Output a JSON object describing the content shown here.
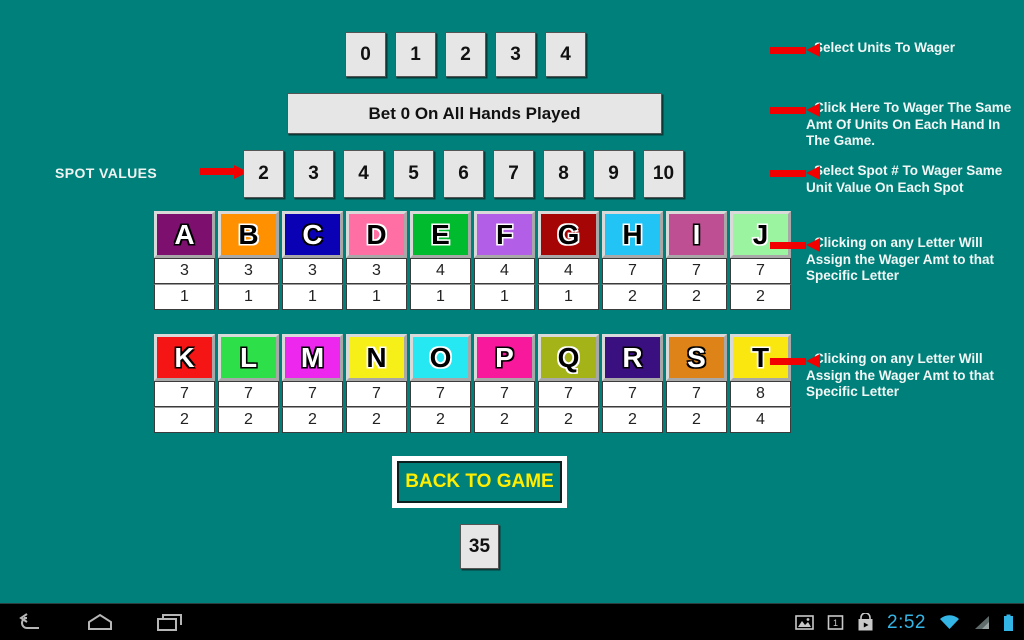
{
  "app": {
    "background_color": "#00807a",
    "accent_red": "#f20000",
    "button_face": "#e6e6e6"
  },
  "units": {
    "label": "units-row",
    "options": [
      "0",
      "1",
      "2",
      "3",
      "4"
    ]
  },
  "bet_all": {
    "label": "Bet 0 On All Hands Played"
  },
  "spot_values": {
    "label": "SPOT VALUES",
    "options": [
      "2",
      "3",
      "4",
      "5",
      "6",
      "7",
      "8",
      "9",
      "10"
    ]
  },
  "letters": {
    "row1": [
      {
        "letter": "A",
        "bg": "#7d0f6e",
        "text": "light",
        "v1": "3",
        "v2": "1"
      },
      {
        "letter": "B",
        "bg": "#ff9000",
        "text": "dark",
        "v1": "3",
        "v2": "1"
      },
      {
        "letter": "C",
        "bg": "#0a00b4",
        "text": "light",
        "v1": "3",
        "v2": "1"
      },
      {
        "letter": "D",
        "bg": "#ff6fa3",
        "text": "dark",
        "v1": "3",
        "v2": "1"
      },
      {
        "letter": "E",
        "bg": "#00bb2d",
        "text": "dark",
        "v1": "4",
        "v2": "1"
      },
      {
        "letter": "F",
        "bg": "#b35ee6",
        "text": "dark",
        "v1": "4",
        "v2": "1"
      },
      {
        "letter": "G",
        "bg": "#a50505",
        "text": "dark",
        "v1": "4",
        "v2": "1"
      },
      {
        "letter": "H",
        "bg": "#22c3f5",
        "text": "dark",
        "v1": "7",
        "v2": "2"
      },
      {
        "letter": "I",
        "bg": "#bd4f92",
        "text": "light",
        "v1": "7",
        "v2": "2"
      },
      {
        "letter": "J",
        "bg": "#9bf5a0",
        "text": "dark",
        "v1": "7",
        "v2": "2"
      }
    ],
    "row2": [
      {
        "letter": "K",
        "bg": "#f51515",
        "text": "light",
        "v1": "7",
        "v2": "2"
      },
      {
        "letter": "L",
        "bg": "#2de04a",
        "text": "light",
        "v1": "7",
        "v2": "2"
      },
      {
        "letter": "M",
        "bg": "#ee27ee",
        "text": "light",
        "v1": "7",
        "v2": "2"
      },
      {
        "letter": "N",
        "bg": "#f7ef18",
        "text": "dark",
        "v1": "7",
        "v2": "2"
      },
      {
        "letter": "O",
        "bg": "#25e8f2",
        "text": "dark",
        "v1": "7",
        "v2": "2"
      },
      {
        "letter": "P",
        "bg": "#f7189b",
        "text": "light",
        "v1": "7",
        "v2": "2"
      },
      {
        "letter": "Q",
        "bg": "#a3b318",
        "text": "dark",
        "v1": "7",
        "v2": "2"
      },
      {
        "letter": "R",
        "bg": "#3a1080",
        "text": "light",
        "v1": "7",
        "v2": "2"
      },
      {
        "letter": "S",
        "bg": "#de8318",
        "text": "light",
        "v1": "7",
        "v2": "2"
      },
      {
        "letter": "T",
        "bg": "#fbe710",
        "text": "dark",
        "v1": "8",
        "v2": "4"
      }
    ]
  },
  "back_to_game": {
    "label": "BACK TO GAME"
  },
  "total": {
    "value": "35"
  },
  "annotations": [
    {
      "id": "ann-1",
      "text": "Select Units To Wager"
    },
    {
      "id": "ann-2",
      "text": "Click Here To Wager The Same Amt Of Units On Each Hand In The Game."
    },
    {
      "id": "ann-3",
      "text": "Select Spot # To Wager Same Unit Value On Each Spot"
    },
    {
      "id": "ann-4",
      "text": "Clicking on any Letter Will Assign the Wager Amt to that Specific Letter"
    },
    {
      "id": "ann-5",
      "text": "Clicking on any Letter Will Assign the Wager Amt to that Specific Letter"
    }
  ],
  "navbar": {
    "back_icon": "back-icon",
    "home_icon": "home-icon",
    "recents_icon": "recents-icon",
    "screenshot_icon": "screenshot-icon",
    "calendar_icon": "calendar-icon",
    "play_store_icon": "play-store-icon",
    "clock": "2:52",
    "wifi_icon": "wifi-icon",
    "signal_icon": "signal-icon",
    "battery_icon": "battery-icon",
    "clock_color": "#33b5e5"
  }
}
